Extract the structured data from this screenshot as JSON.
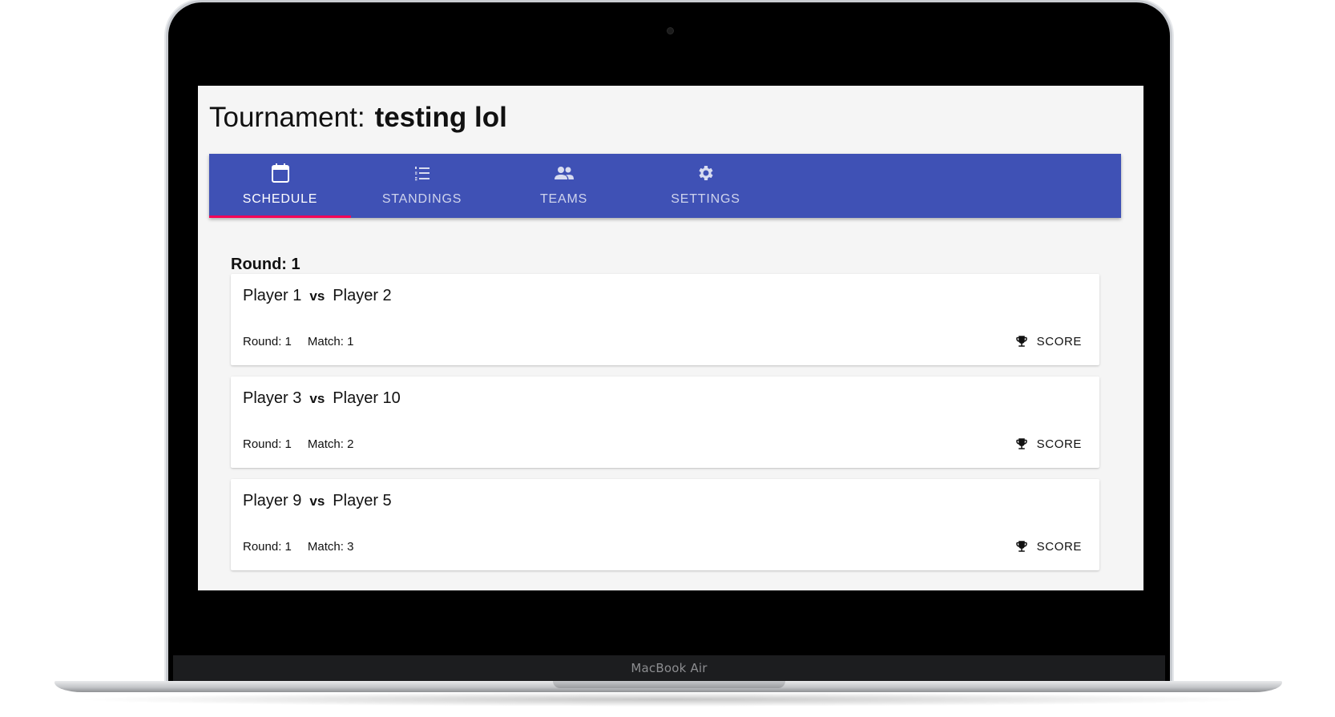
{
  "device": {
    "brand_label": "MacBook Air"
  },
  "header": {
    "label": "Tournament:",
    "name": "testing lol"
  },
  "tabs": [
    {
      "label": "SCHEDULE",
      "icon": "calendar-icon",
      "active": true
    },
    {
      "label": "STANDINGS",
      "icon": "list-numbered-icon",
      "active": false
    },
    {
      "label": "TEAMS",
      "icon": "people-icon",
      "active": false
    },
    {
      "label": "SETTINGS",
      "icon": "gear-icon",
      "active": false
    }
  ],
  "accent_colors": {
    "tabbar": "#3f51b5",
    "indicator": "#f50057"
  },
  "schedule": {
    "round_heading": "Round: 1",
    "matches": [
      {
        "player1": "Player 1",
        "vs": "vs",
        "player2": "Player 2",
        "round": "Round: 1",
        "match": "Match: 1",
        "action": "SCORE",
        "action_icon": "trophy-icon"
      },
      {
        "player1": "Player 3",
        "vs": "vs",
        "player2": "Player 10",
        "round": "Round: 1",
        "match": "Match: 2",
        "action": "SCORE",
        "action_icon": "trophy-icon"
      },
      {
        "player1": "Player 9",
        "vs": "vs",
        "player2": "Player 5",
        "round": "Round: 1",
        "match": "Match: 3",
        "action": "SCORE",
        "action_icon": "trophy-icon"
      }
    ]
  }
}
